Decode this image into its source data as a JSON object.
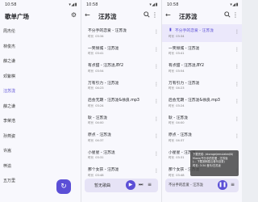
{
  "status_time": "10:58",
  "status_icons": "▾◢▮",
  "panel1": {
    "title": "歌单广场",
    "nav": [
      "周杰伦",
      "林俊杰",
      "薛之谦",
      "邓紫棋",
      "汪苏泷",
      "薛之谦",
      "李荣浩",
      "孙燕姿",
      "许嵩",
      "梓渝",
      "五万里"
    ],
    "active_index": 4
  },
  "artist_title": "汪苏泷",
  "duration_label": "时长",
  "songs_p2": [
    {
      "name": "不分手的恋爱 - 汪苏泷",
      "time": "03:34"
    },
    {
      "name": "一笑倾城 - 汪苏泷",
      "time": "03:41"
    },
    {
      "name": "有点甜 - 汪苏泷,BY2",
      "time": "03:54"
    },
    {
      "name": "万有引力 - 汪苏泷",
      "time": "04:23"
    },
    {
      "name": "后会无期 - 汪苏泷&徐良.mp3",
      "time": "03:24"
    },
    {
      "name": "耿 - 汪苏泷",
      "time": "04:00"
    },
    {
      "name": "原点 - 汪苏泷",
      "time": "04:37"
    },
    {
      "name": "小星星 - 汪苏泷",
      "time": "03:31"
    },
    {
      "name": "那个女孩 - 汪苏泷",
      "time": "03:48"
    }
  ],
  "songs_p3": [
    {
      "name": "不分手的恋爱 - 汪苏泷",
      "time": "03:34"
    },
    {
      "name": "一笑倾城 - 汪苏泷",
      "time": "03:41"
    },
    {
      "name": "有点甜 - 汪苏泷,BY2",
      "time": "03:54"
    },
    {
      "name": "万有引力 - 汪苏泷",
      "time": "04:23"
    },
    {
      "name": "后会无期 - 汪苏泷&徐良.mp3",
      "time": "03:24"
    },
    {
      "name": "耿 - 汪苏泷",
      "time": "04:00"
    },
    {
      "name": "原点 - 汪苏泷",
      "time": "04:37"
    },
    {
      "name": "小星星 - 汪苏泷",
      "time": "03:31"
    },
    {
      "name": "那个女孩 - 汪苏泷",
      "time": "03:48"
    }
  ],
  "player_p2": {
    "title": "暂无歌曲"
  },
  "player_p3": {
    "title": "不分手的恋爱 - 汪苏泷"
  },
  "toast_lines": [
    "下载完成: /storage/emulated/0/",
    "Music/不分手的恋爱 - 汪苏泷",
    "(... 下载到网易云音乐目录)",
    "时长: 3:34 音乐/汪苏泷"
  ],
  "icons": {
    "gear": "gear-icon",
    "back": "back-arrow-icon",
    "more": "more-vert-icon",
    "play": "play-icon",
    "pause": "pause-icon",
    "next": "skip-next-icon",
    "queue": "queue-icon",
    "refresh": "refresh-icon"
  }
}
